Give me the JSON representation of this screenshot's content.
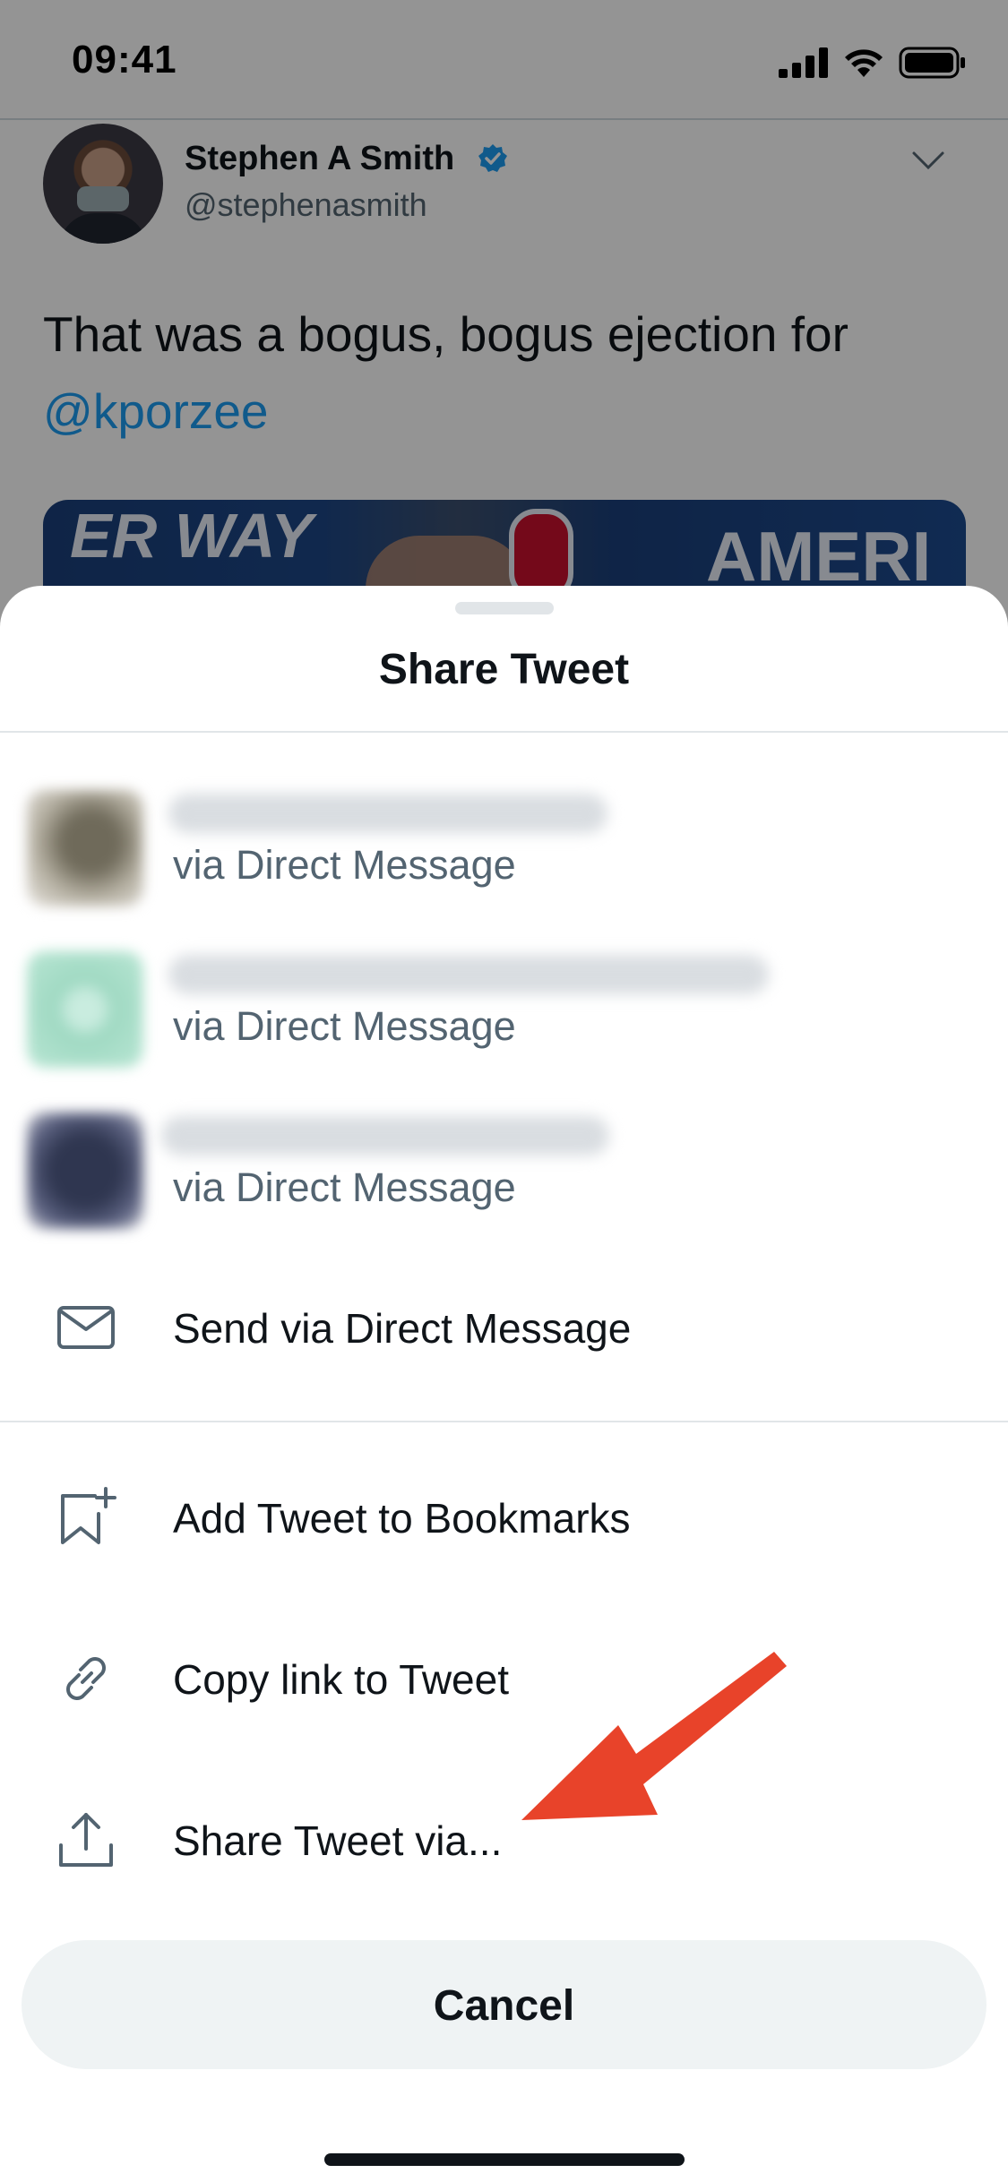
{
  "status_bar": {
    "time": "09:41"
  },
  "tweet": {
    "author_name": "Stephen A Smith",
    "author_handle": "@stephenasmith",
    "text": "That was a bogus, bogus ejection for",
    "mention": "@kporzee",
    "media_text_left": "ER WAY",
    "media_text_right": "AMERI"
  },
  "sheet": {
    "title": "Share Tweet",
    "dm_suggestions": [
      {
        "subtitle": "via Direct Message"
      },
      {
        "subtitle": "via Direct Message"
      },
      {
        "subtitle": "via Direct Message"
      }
    ],
    "actions": {
      "send_dm": "Send via Direct Message",
      "bookmark": "Add Tweet to Bookmarks",
      "copy_link": "Copy link to Tweet",
      "share_via": "Share Tweet via..."
    },
    "cancel_label": "Cancel"
  },
  "icons": {
    "signal": "signal-icon",
    "wifi": "wifi-icon",
    "battery": "battery-icon",
    "verified": "verified-badge-icon",
    "chevron": "chevron-down-icon",
    "envelope": "envelope-icon",
    "bookmark": "bookmark-add-icon",
    "link": "link-icon",
    "share": "share-upload-icon",
    "annotation_arrow": "red-arrow-icon"
  },
  "colors": {
    "twitter_blue": "#1d9bf0",
    "annotation_red": "#e8432a",
    "cancel_bg": "#eff3f4"
  }
}
